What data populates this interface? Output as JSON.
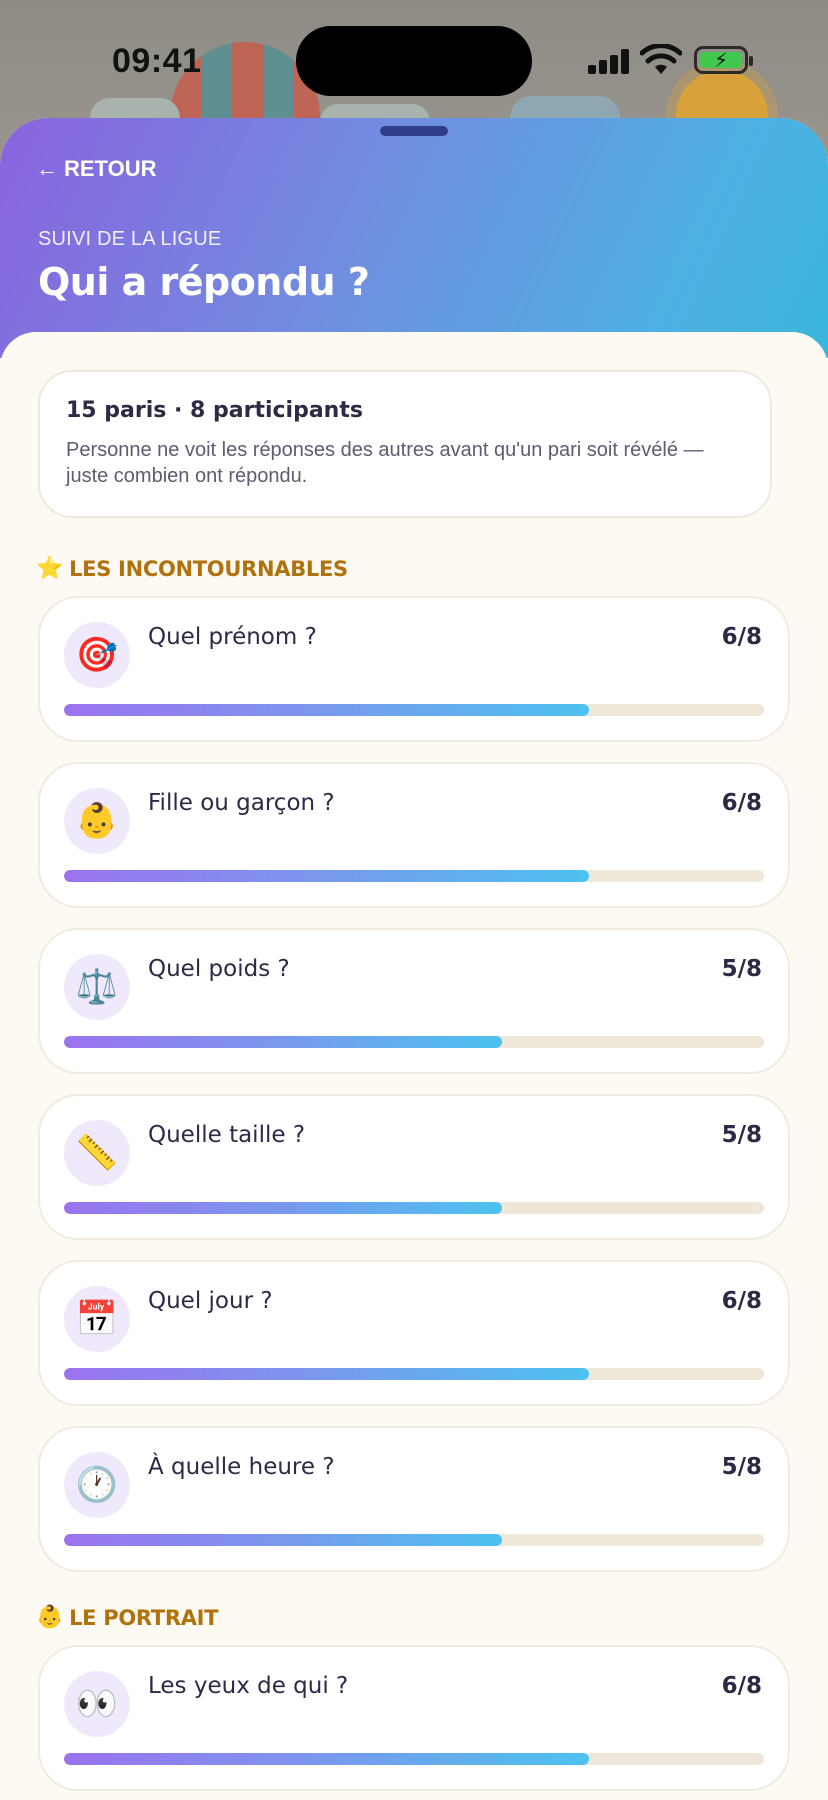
{
  "status_bar": {
    "time": "09:41"
  },
  "header": {
    "back_label": "RETOUR",
    "overline": "SUIVI DE LA LIGUE",
    "title": "Qui a répondu ?"
  },
  "summary": {
    "title": "15 paris · 8 participants",
    "text": "Personne ne voit les réponses des autres avant qu'un pari soit révélé — juste combien ont répondu."
  },
  "sections": [
    {
      "emoji": "⭐",
      "label": "LES INCONTOURNABLES",
      "items": [
        {
          "icon": "🎯",
          "icon_name": "target-icon",
          "question": "Quel prénom ?",
          "count": "6/8",
          "progress": 0.75
        },
        {
          "icon": "👶",
          "icon_name": "baby-icon",
          "question": "Fille ou garçon ?",
          "count": "6/8",
          "progress": 0.75
        },
        {
          "icon": "⚖️",
          "icon_name": "scale-icon",
          "question": "Quel poids ?",
          "count": "5/8",
          "progress": 0.625
        },
        {
          "icon": "📏",
          "icon_name": "ruler-icon",
          "question": "Quelle taille ?",
          "count": "5/8",
          "progress": 0.625
        },
        {
          "icon": "📅",
          "icon_name": "calendar-icon",
          "question": "Quel jour ?",
          "count": "6/8",
          "progress": 0.75
        },
        {
          "icon": "🕐",
          "icon_name": "clock-icon",
          "question": "À quelle heure ?",
          "count": "5/8",
          "progress": 0.625
        }
      ]
    },
    {
      "emoji": "👶",
      "label": "LE PORTRAIT",
      "items": [
        {
          "icon": "👀",
          "icon_name": "eyes-icon",
          "question": "Les yeux de qui ?",
          "count": "6/8",
          "progress": 0.75
        }
      ]
    }
  ]
}
